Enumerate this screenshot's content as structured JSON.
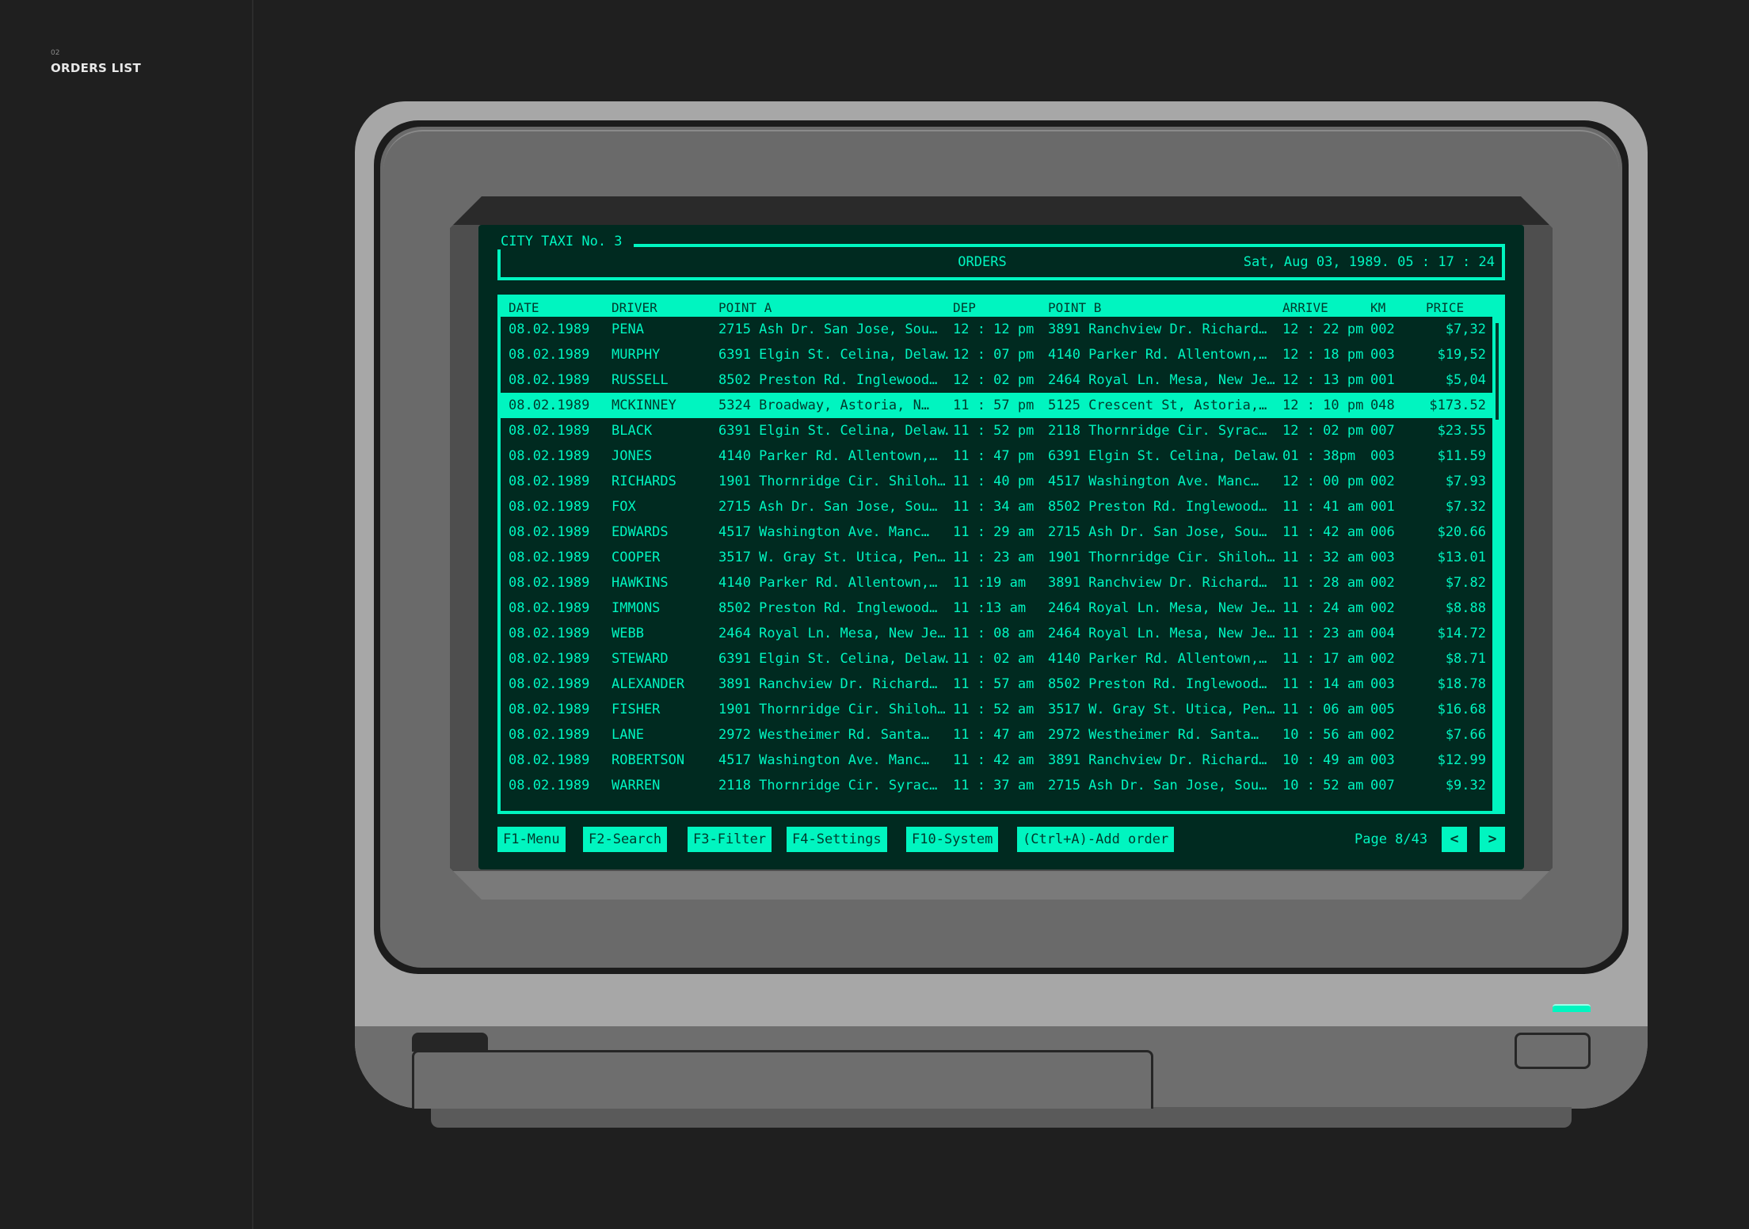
{
  "sidebar": {
    "number": "02",
    "title": "ORDERS LIST"
  },
  "header": {
    "brand": "CITY TAXI No. 3",
    "title": "ORDERS",
    "datetime": "Sat, Aug 03, 1989. 05 : 17 : 24"
  },
  "columns": [
    "DATE",
    "DRIVER",
    "POINT A",
    "DEP",
    "POINT B",
    "ARRIVE",
    "KM",
    "PRICE"
  ],
  "rows": [
    {
      "date": "08.02.1989",
      "driver": "PENA",
      "point_a": "2715 Ash Dr. San Jose, Sou…",
      "dep": "12 : 12 pm",
      "point_b": "3891 Ranchview Dr. Richard…",
      "arrive": "12 : 22 pm",
      "km": "002",
      "price": "$7,32"
    },
    {
      "date": "08.02.1989",
      "driver": "MURPHY",
      "point_a": "6391 Elgin St. Celina, Delaw…",
      "dep": "12 : 07 pm",
      "point_b": "4140 Parker Rd. Allentown,…",
      "arrive": "12 : 18 pm",
      "km": "003",
      "price": "$19,52"
    },
    {
      "date": "08.02.1989",
      "driver": "RUSSELL",
      "point_a": "8502 Preston Rd. Inglewood…",
      "dep": "12 : 02 pm",
      "point_b": "2464 Royal Ln. Mesa, New Je…",
      "arrive": "12 : 13 pm",
      "km": "001",
      "price": "$5,04"
    },
    {
      "date": "08.02.1989",
      "driver": "MCKINNEY",
      "point_a": "5324 Broadway, Astoria, N…",
      "dep": "11 : 57 pm",
      "point_b": "5125 Crescent St, Astoria,…",
      "arrive": "12 : 10 pm",
      "km": "048",
      "price": "$173.52",
      "selected": true
    },
    {
      "date": "08.02.1989",
      "driver": "BLACK",
      "point_a": "6391 Elgin St. Celina, Delaw…",
      "dep": "11 : 52 pm",
      "point_b": "2118 Thornridge Cir. Syrac…",
      "arrive": "12 : 02 pm",
      "km": "007",
      "price": "$23.55"
    },
    {
      "date": "08.02.1989",
      "driver": "JONES",
      "point_a": "4140 Parker Rd. Allentown,…",
      "dep": "11 : 47 pm",
      "point_b": "6391 Elgin St. Celina, Delaw…",
      "arrive": "01 : 38pm",
      "km": "003",
      "price": "$11.59"
    },
    {
      "date": "08.02.1989",
      "driver": "RICHARDS",
      "point_a": "1901 Thornridge Cir. Shiloh…",
      "dep": "11 : 40 pm",
      "point_b": "4517 Washington Ave. Manc…",
      "arrive": "12 : 00 pm",
      "km": "002",
      "price": "$7.93"
    },
    {
      "date": "08.02.1989",
      "driver": "FOX",
      "point_a": "2715 Ash Dr. San Jose, Sou…",
      "dep": "11 : 34 am",
      "point_b": "8502 Preston Rd. Inglewood…",
      "arrive": "11 : 41 am",
      "km": "001",
      "price": "$7.32"
    },
    {
      "date": "08.02.1989",
      "driver": "EDWARDS",
      "point_a": "4517 Washington Ave. Manc…",
      "dep": "11 : 29 am",
      "point_b": "2715 Ash Dr. San Jose, Sou…",
      "arrive": "11 : 42 am",
      "km": "006",
      "price": "$20.66"
    },
    {
      "date": "08.02.1989",
      "driver": "COOPER",
      "point_a": "3517 W. Gray St. Utica, Pen…",
      "dep": "11 : 23 am",
      "point_b": "1901 Thornridge Cir. Shiloh…",
      "arrive": "11 : 32 am",
      "km": "003",
      "price": "$13.01"
    },
    {
      "date": "08.02.1989",
      "driver": "HAWKINS",
      "point_a": "4140 Parker Rd. Allentown,…",
      "dep": "11 :19 am",
      "point_b": "3891 Ranchview Dr. Richard…",
      "arrive": "11 : 28 am",
      "km": "002",
      "price": "$7.82"
    },
    {
      "date": "08.02.1989",
      "driver": "IMMONS",
      "point_a": "8502 Preston Rd. Inglewood…",
      "dep": "11 :13 am",
      "point_b": "2464 Royal Ln. Mesa, New Je…",
      "arrive": "11 : 24 am",
      "km": "002",
      "price": "$8.88"
    },
    {
      "date": "08.02.1989",
      "driver": "WEBB",
      "point_a": "2464 Royal Ln. Mesa, New Je…",
      "dep": "11 : 08 am",
      "point_b": "2464 Royal Ln. Mesa, New Je…",
      "arrive": "11 : 23 am",
      "km": "004",
      "price": "$14.72"
    },
    {
      "date": "08.02.1989",
      "driver": "STEWARD",
      "point_a": "6391 Elgin St. Celina, Delaw…",
      "dep": "11 : 02 am",
      "point_b": "4140 Parker Rd. Allentown,…",
      "arrive": "11 : 17 am",
      "km": "002",
      "price": "$8.71"
    },
    {
      "date": "08.02.1989",
      "driver": "ALEXANDER",
      "point_a": "3891 Ranchview Dr. Richard…",
      "dep": "11 : 57 am",
      "point_b": "8502 Preston Rd. Inglewood…",
      "arrive": "11 : 14 am",
      "km": "003",
      "price": "$18.78"
    },
    {
      "date": "08.02.1989",
      "driver": "FISHER",
      "point_a": "1901 Thornridge Cir. Shiloh…",
      "dep": "11 : 52 am",
      "point_b": "3517 W. Gray St. Utica, Pen…",
      "arrive": "11 : 06 am",
      "km": "005",
      "price": "$16.68"
    },
    {
      "date": "08.02.1989",
      "driver": "LANE",
      "point_a": "2972 Westheimer Rd. Santa…",
      "dep": "11 : 47 am",
      "point_b": "2972 Westheimer Rd. Santa…",
      "arrive": "10 : 56 am",
      "km": "002",
      "price": "$7.66"
    },
    {
      "date": "08.02.1989",
      "driver": "ROBERTSON",
      "point_a": "4517 Washington Ave. Manc…",
      "dep": "11 : 42 am",
      "point_b": "3891 Ranchview Dr. Richard…",
      "arrive": "10 : 49 am",
      "km": "003",
      "price": "$12.99"
    },
    {
      "date": "08.02.1989",
      "driver": "WARREN",
      "point_a": "2118 Thornridge Cir. Syrac…",
      "dep": "11 : 37 am",
      "point_b": "2715 Ash Dr. San Jose, Sou…",
      "arrive": "10 : 52 am",
      "km": "007",
      "price": "$9.32"
    }
  ],
  "footer": {
    "keys": [
      "F1-Menu",
      "F2-Search",
      "F3-Filter",
      "F4-Settings",
      "F10-System",
      "(Ctrl+A)-Add order"
    ],
    "page_label": "Page 8/43",
    "prev_icon": "chevron-left-icon",
    "next_icon": "chevron-right-icon",
    "prev_glyph": "<",
    "next_glyph": ">"
  },
  "colors": {
    "accent": "#00f5c0",
    "screen_bg": "#002a20",
    "page_bg": "#1f1f1f",
    "case": "#a7a7a7"
  }
}
